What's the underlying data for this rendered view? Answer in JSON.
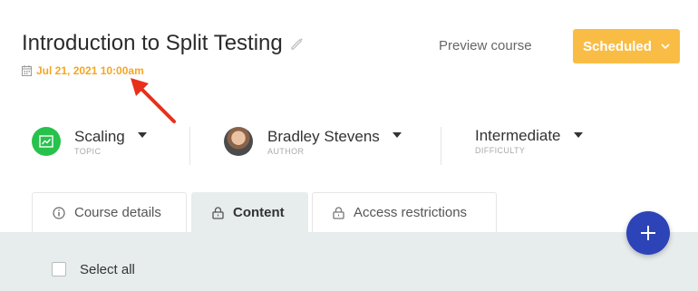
{
  "header": {
    "title": "Introduction to Split Testing",
    "date": "Jul 21, 2021 10:00am",
    "preview_label": "Preview course",
    "status_label": "Scheduled"
  },
  "meta": {
    "topic": {
      "value": "Scaling",
      "label": "TOPIC"
    },
    "author": {
      "value": "Bradley Stevens",
      "label": "AUTHOR"
    },
    "difficulty": {
      "value": "Intermediate",
      "label": "DIFFICULTY"
    }
  },
  "tabs": [
    {
      "label": "Course details",
      "icon": "info-icon"
    },
    {
      "label": "Content",
      "icon": "lock-icon"
    },
    {
      "label": "Access restrictions",
      "icon": "lock-icon"
    }
  ],
  "content": {
    "select_all_label": "Select all"
  },
  "colors": {
    "accent": "#f9bd45",
    "date": "#f5a623",
    "topic": "#27c24c",
    "fab": "#2c44b8",
    "arrow": "#e8301c"
  }
}
